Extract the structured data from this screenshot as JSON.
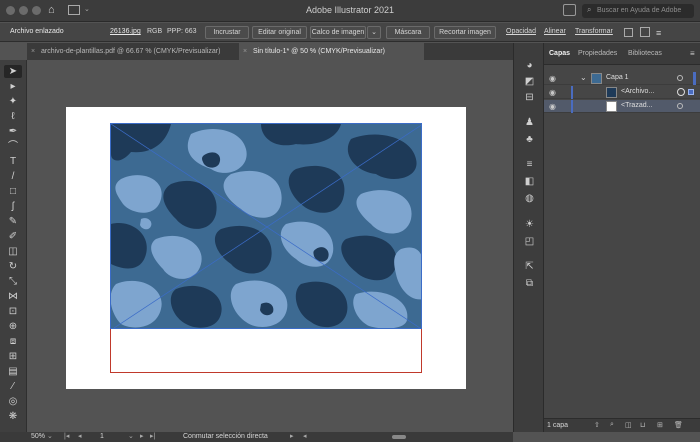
{
  "app": {
    "title": "Adobe Illustrator 2021"
  },
  "search": {
    "placeholder": "Buscar en Ayuda de Adobe"
  },
  "controlbar": {
    "object_type": "Archivo enlazado",
    "filename": "26136.jpg",
    "color_mode": "RGB",
    "ppp": "PPP: 663",
    "embed_label": "Incrustar",
    "edit_original_label": "Editar original",
    "image_trace_label": "Calco de imagen",
    "mask_label": "Máscara",
    "crop_label": "Recortar imagen",
    "opacity_label": "Opacidad",
    "align_label": "Alinear",
    "transform_label": "Transformar"
  },
  "tabs": [
    {
      "label": "archivo-de-plantillas.pdf @ 66.67 % (CMYK/Previsualizar)"
    },
    {
      "label": "Sin título-1* @ 50 % (CMYK/Previsualizar)"
    }
  ],
  "panel": {
    "tabs": [
      "Capas",
      "Propiedades",
      "Bibliotecas"
    ],
    "layers": [
      {
        "name": "Capa 1"
      },
      {
        "name": "<Archivo..."
      },
      {
        "name": "<Trazad..."
      }
    ],
    "footer": "1 capa"
  },
  "statusbar": {
    "zoom": "50%",
    "artboard_number": "1",
    "message": "Conmutar selección directa"
  },
  "colors": {
    "camo_dark": "#1e3a58",
    "camo_mid": "#3d6a92",
    "camo_light": "#7ea5cf",
    "layer_color": "#4a6cc0",
    "path_color": "#c0392b"
  }
}
